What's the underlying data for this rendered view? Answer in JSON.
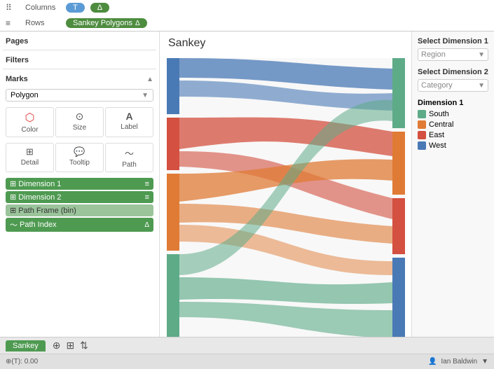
{
  "toolbar": {
    "columns_label": "Columns",
    "rows_label": "Rows",
    "columns_pill": "T",
    "columns_pill2": "Δ",
    "rows_pill": "Sankey Polygons",
    "rows_pill_delta": "Δ"
  },
  "left_sidebar": {
    "pages_title": "Pages",
    "filters_title": "Filters",
    "marks_title": "Marks",
    "marks_collapse": "▲",
    "mark_type": "Polygon",
    "buttons": [
      {
        "icon": "⬡",
        "label": "Color"
      },
      {
        "icon": "⊙",
        "label": "Size"
      },
      {
        "icon": "A",
        "label": "Label"
      },
      {
        "icon": "⊞",
        "label": "Detail"
      },
      {
        "icon": "⬜",
        "label": "Tooltip"
      },
      {
        "icon": "~",
        "label": "Path"
      }
    ],
    "fields": [
      {
        "name": "Dimension 1",
        "color": "green",
        "end": "≡"
      },
      {
        "name": "Dimension 2",
        "color": "green",
        "end": "≡"
      },
      {
        "name": "Path Frame (bin)",
        "color": "lightgreen",
        "end": ""
      },
      {
        "name": "Path Index",
        "color": "green",
        "end": "Δ",
        "icon": "~"
      }
    ]
  },
  "chart": {
    "title": "Sankey"
  },
  "right_panel": {
    "dim1_title": "Select Dimension 1",
    "dim1_value": "Region",
    "dim2_title": "Select Dimension 2",
    "dim2_value": "Category",
    "legend_title": "Dimension 1",
    "legend_items": [
      {
        "label": "South",
        "color": "#5eab88"
      },
      {
        "label": "Central",
        "color": "#e07b35"
      },
      {
        "label": "East",
        "color": "#d45040"
      },
      {
        "label": "West",
        "color": "#4a7ab5"
      }
    ]
  },
  "bottom": {
    "tab_label": "Sankey",
    "status_left": "⊕(T): 0.00",
    "status_user": "Ian Baldwin"
  }
}
